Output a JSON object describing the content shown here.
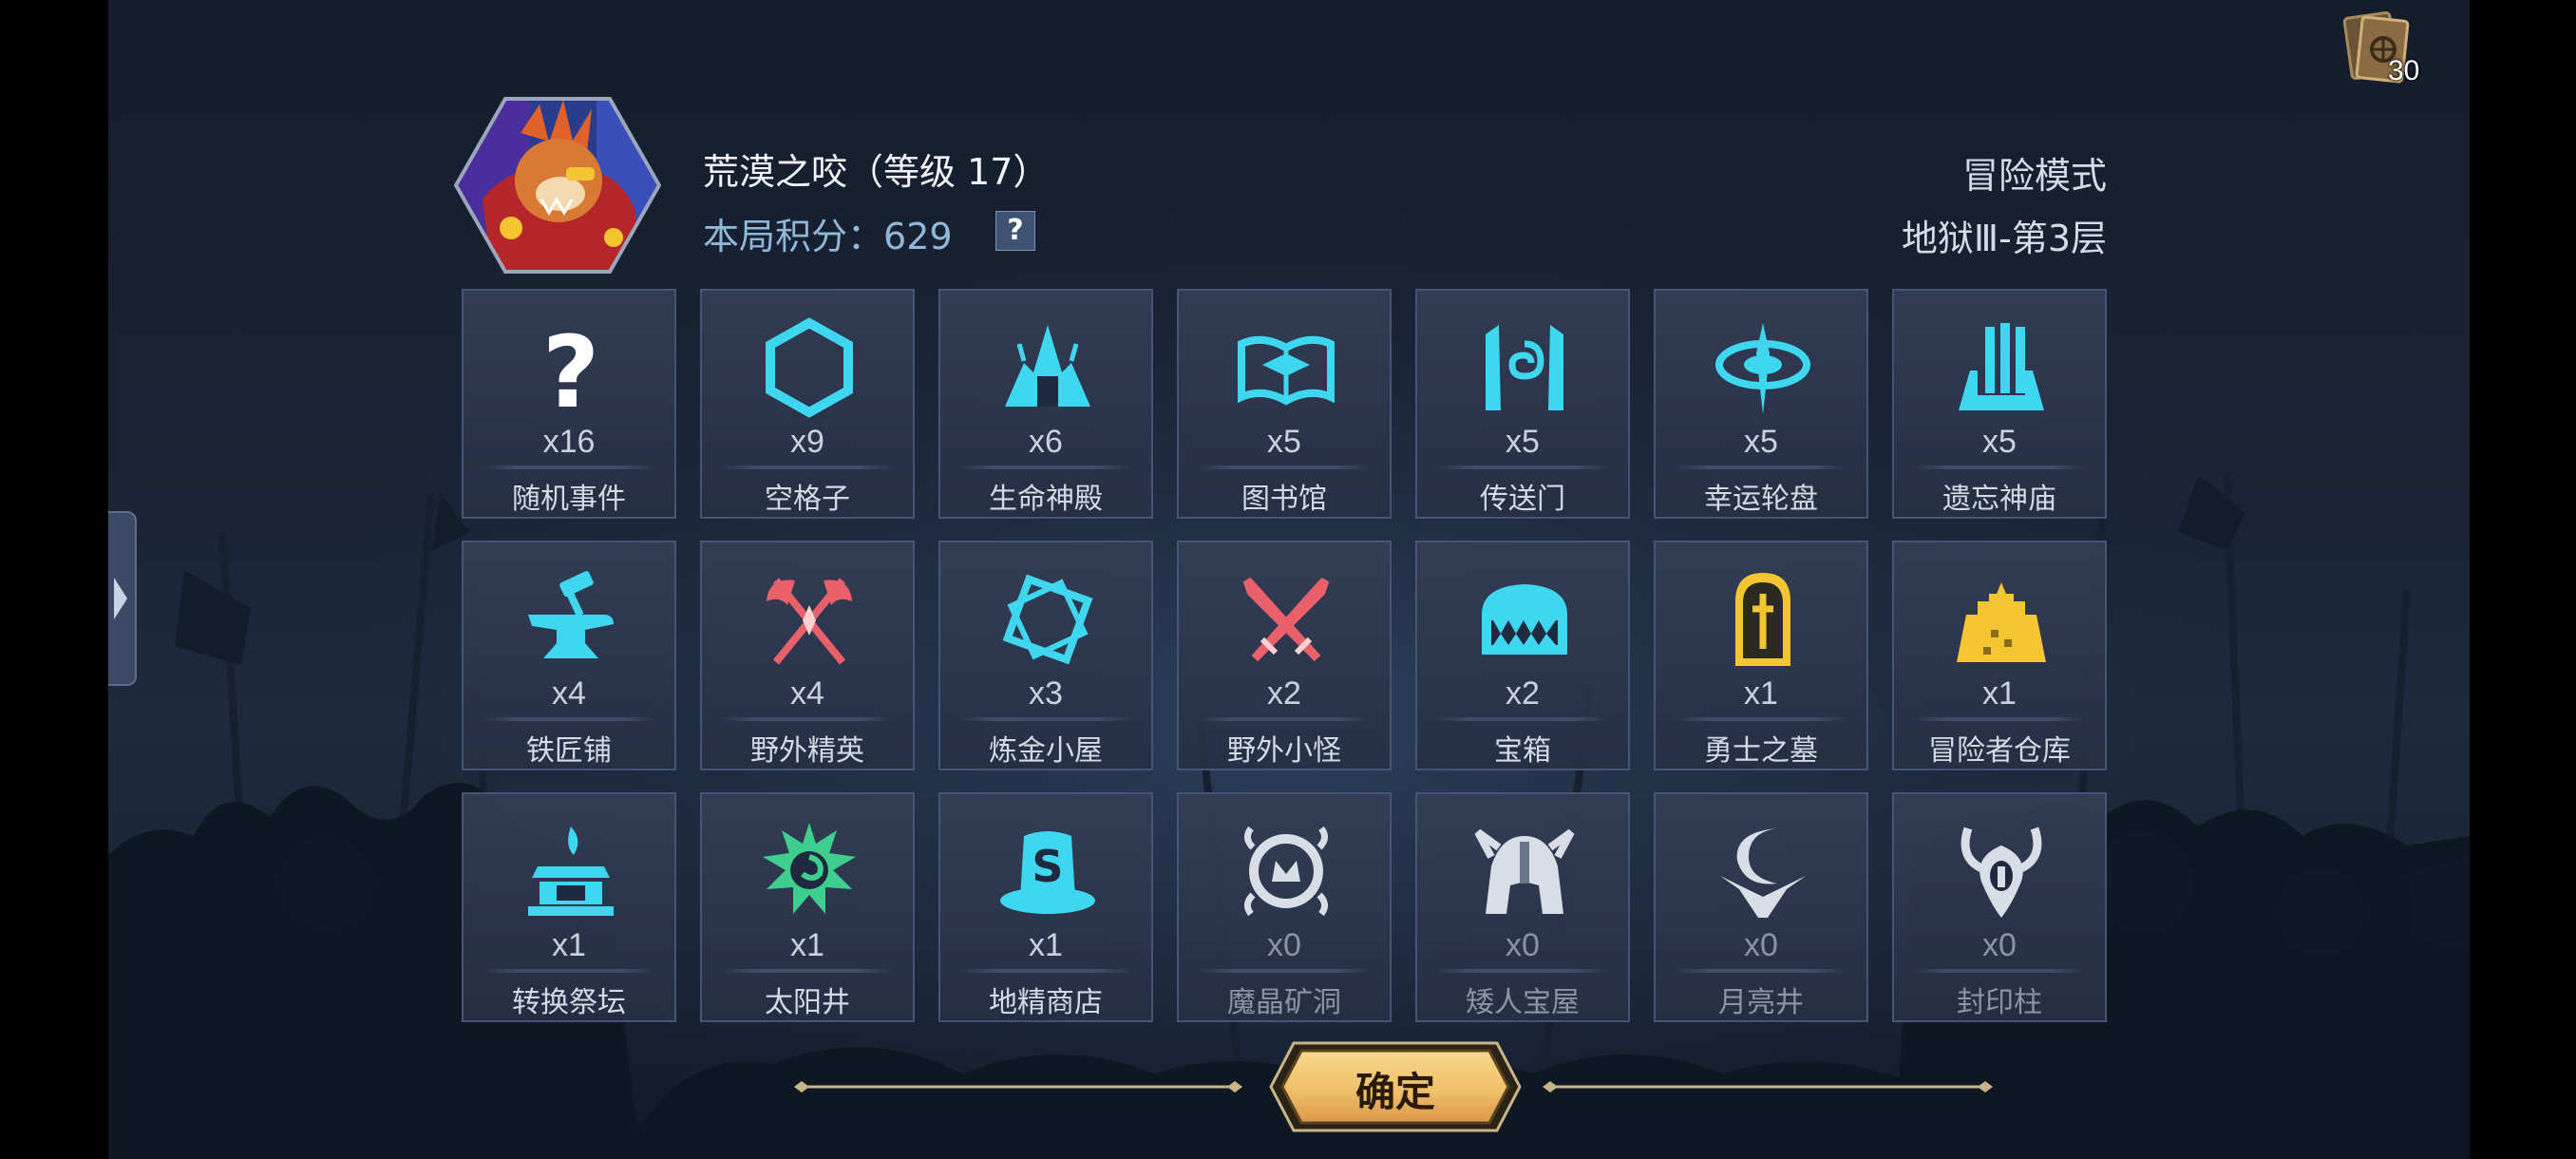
{
  "deck": {
    "count": "30",
    "icon": "card-deck-icon"
  },
  "hero": {
    "name": "荒漠之咬（等级 17）",
    "score_label": "本局积分：",
    "score_value": "629",
    "help_label": "?"
  },
  "mode": {
    "title": "冒险模式",
    "stage": "地狱Ⅲ-第3层"
  },
  "tiles": [
    {
      "name": "随机事件",
      "count": "x16",
      "icon": "question-mark-icon",
      "color": "#ffffff"
    },
    {
      "name": "空格子",
      "count": "x9",
      "icon": "hexagon-icon",
      "color": "#3fd6f0"
    },
    {
      "name": "生命神殿",
      "count": "x6",
      "icon": "life-temple-icon",
      "color": "#3fd6f0"
    },
    {
      "name": "图书馆",
      "count": "x5",
      "icon": "open-book-icon",
      "color": "#3fd6f0"
    },
    {
      "name": "传送门",
      "count": "x5",
      "icon": "portal-gate-icon",
      "color": "#3fd6f0"
    },
    {
      "name": "幸运轮盘",
      "count": "x5",
      "icon": "lucky-wheel-icon",
      "color": "#3fd6f0"
    },
    {
      "name": "遗忘神庙",
      "count": "x5",
      "icon": "forgotten-temple-icon",
      "color": "#3fd6f0"
    },
    {
      "name": "铁匠铺",
      "count": "x4",
      "icon": "anvil-hammer-icon",
      "color": "#3fd6f0"
    },
    {
      "name": "野外精英",
      "count": "x4",
      "icon": "crossed-axes-icon",
      "color": "#e8606a"
    },
    {
      "name": "炼金小屋",
      "count": "x3",
      "icon": "alchemy-frame-icon",
      "color": "#3fd6f0"
    },
    {
      "name": "野外小怪",
      "count": "x2",
      "icon": "crossed-swords-icon",
      "color": "#e8606a"
    },
    {
      "name": "宝箱",
      "count": "x2",
      "icon": "mimic-chest-icon",
      "color": "#3fd6f0"
    },
    {
      "name": "勇士之墓",
      "count": "x1",
      "icon": "tombstone-icon",
      "color": "#f2c531"
    },
    {
      "name": "冒险者仓库",
      "count": "x1",
      "icon": "castle-warehouse-icon",
      "color": "#f2c531"
    },
    {
      "name": "转换祭坛",
      "count": "x1",
      "icon": "altar-icon",
      "color": "#3fd6f0"
    },
    {
      "name": "太阳井",
      "count": "x1",
      "icon": "sun-well-icon",
      "color": "#3ecf8e"
    },
    {
      "name": "地精商店",
      "count": "x1",
      "icon": "goblin-shop-hat-icon",
      "color": "#3fd6f0"
    },
    {
      "name": "魔晶矿洞",
      "count": "x0",
      "icon": "crystal-mine-icon",
      "color": "#d8dde6"
    },
    {
      "name": "矮人宝屋",
      "count": "x0",
      "icon": "dwarf-helmet-icon",
      "color": "#d8dde6"
    },
    {
      "name": "月亮井",
      "count": "x0",
      "icon": "moon-well-icon",
      "color": "#d8dde6"
    },
    {
      "name": "封印柱",
      "count": "x0",
      "icon": "seal-pillar-icon",
      "color": "#d8dde6"
    }
  ],
  "confirm": {
    "label": "确定"
  },
  "colors": {
    "accent_cyan": "#3fd6f0",
    "enemy_red": "#e8606a",
    "gold": "#f2c531",
    "score_blue": "#8fb8d8",
    "button_gold": "#f0c06a"
  }
}
